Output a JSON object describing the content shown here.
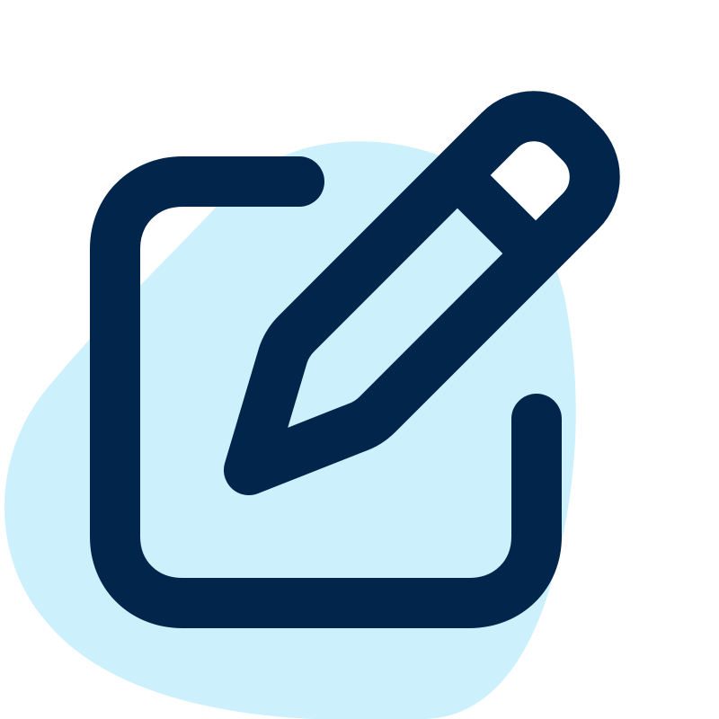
{
  "icon": {
    "name": "edit-icon",
    "parts": [
      "background-blob",
      "square-frame-icon",
      "pencil-icon"
    ]
  },
  "colors": {
    "background": "#ffffff",
    "blob": "#cdf0fd",
    "stroke": "#02264b",
    "pencil_eraser": "#ffffff"
  }
}
